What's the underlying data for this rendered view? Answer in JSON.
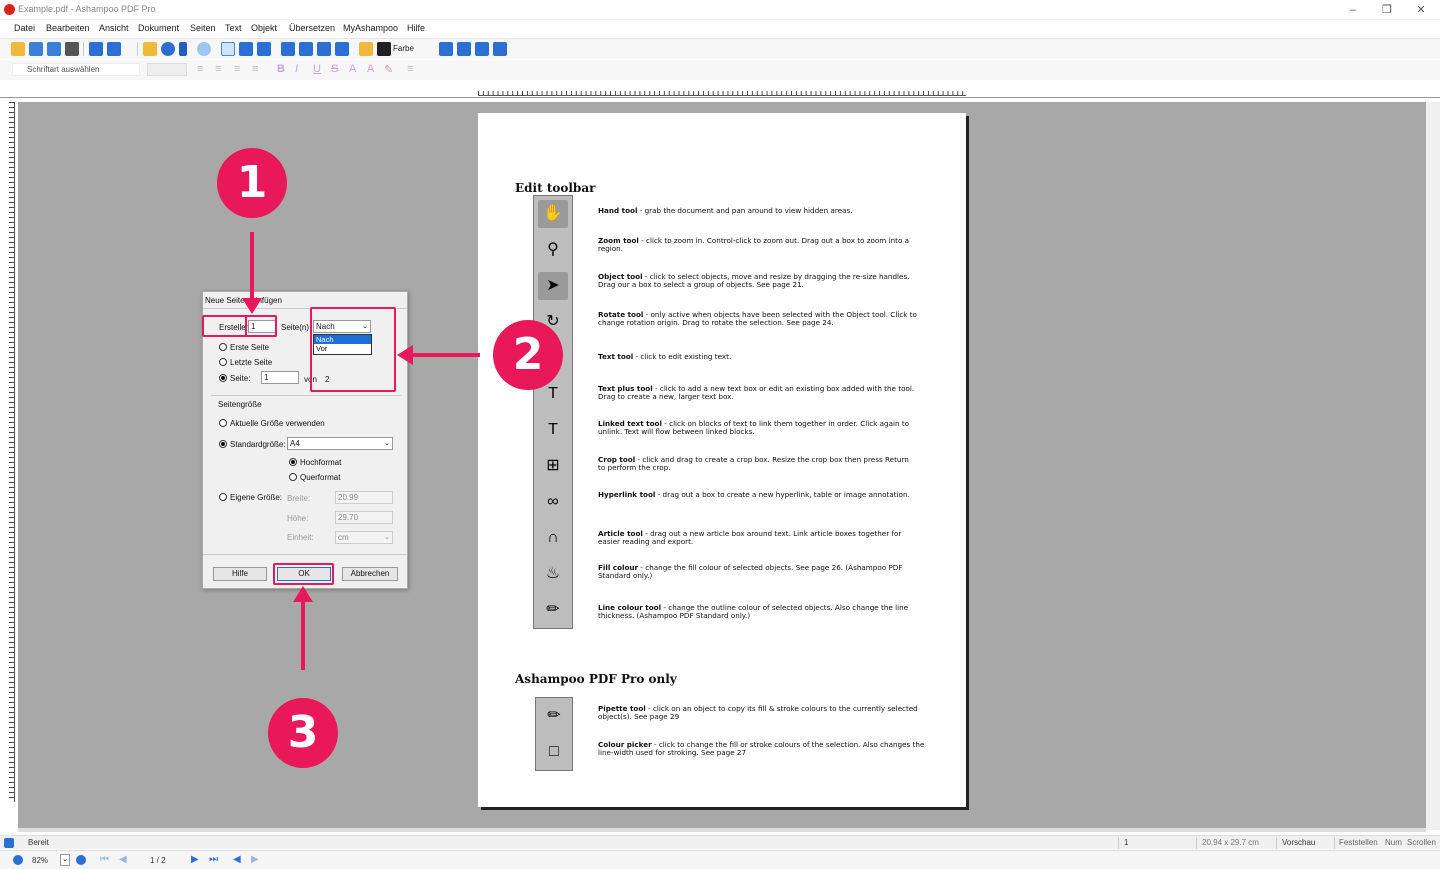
{
  "window": {
    "title": "Example.pdf - Ashampoo PDF Pro"
  },
  "menu": [
    "Datei",
    "Bearbeiten",
    "Ansicht",
    "Dokument",
    "Seiten",
    "Text",
    "Objekt",
    "Übersetzen",
    "MyAshampoo",
    "Hilfe"
  ],
  "toolbar": {
    "color_label": "Farbe",
    "font_placeholder": "Schriftart auswählen"
  },
  "page": {
    "heading1": "Edit toolbar",
    "tools": [
      {
        "name": "Hand tool",
        "desc": "- grab the document and pan around to view hidden areas."
      },
      {
        "name": "Zoom tool",
        "desc": "- click to zoom in. Control-click to zoom out. Drag out a box to zoom into a region."
      },
      {
        "name": "Object tool",
        "desc": "- click to select objects, move and resize by dragging the re-size handles. Drag our a box to select a group of objects. See page 21."
      },
      {
        "name": "Rotate tool",
        "desc": "- only active when objects have been selected with the Object tool. Click to change rotation origin. Drag to rotate the selection. See page 24."
      },
      {
        "name": "Text tool",
        "desc": "- click to edit existing text."
      },
      {
        "name": "Text plus tool",
        "desc": "- click to add a new text box or edit an existing box added with the tool. Drag to create a new, larger text box."
      },
      {
        "name": "Linked text tool",
        "desc": "- click on blocks of text to link them together in order. Click again to unlink. Text will flow between linked blocks."
      },
      {
        "name": "Crop tool",
        "desc": "- click and drag to create a crop box. Resize the crop box then press Return to perform the crop."
      },
      {
        "name": "Hyperlink tool",
        "desc": "- drag out a box to create a new hyperlink, table or image annotation."
      },
      {
        "name": "Article tool",
        "desc": "- drag out a new article box around text. Link article boxes together for easier reading and export."
      },
      {
        "name": "Fill colour",
        "desc": "- change the fill colour of selected objects. See page 26. (Ashampoo PDF Standard only.)"
      },
      {
        "name": "Line colour tool",
        "desc": "- change the outline colour of selected objects. Also change the line thickness. (Ashampoo PDF Standard only.)"
      }
    ],
    "heading2": "Ashampoo PDF Pro only",
    "pro_tools": [
      {
        "name": "Pipette tool",
        "desc": "- click on an object to copy its fill & stroke colours to the currently selected object(s). See page 29"
      },
      {
        "name": "Colour picker",
        "desc": "- click to change the fill or stroke colours of the selection. Also changes the line-width used for stroking. See page 27"
      }
    ]
  },
  "dialog": {
    "title": "Neue Seiten einfügen",
    "create_label": "Erstellen",
    "create_value": "1",
    "pages_label": "Seite(n)",
    "position_selected": "Nach",
    "position_options": [
      "Nach",
      "Vor"
    ],
    "first_page": "Erste Seite",
    "last_page": "Letzte Seite",
    "page_label": "Seite:",
    "page_value": "1",
    "of_label": "von",
    "of_value": "2",
    "size_group": "Seitengröße",
    "current_size": "Aktuelle Größe verwenden",
    "standard_size": "Standardgröße:",
    "standard_value": "A4",
    "portrait": "Hochformat",
    "landscape": "Querformat",
    "custom_size": "Eigene Größe:",
    "width_label": "Breite:",
    "width_value": "20.99",
    "height_label": "Höhe:",
    "height_value": "29.70",
    "unit_label": "Einheit:",
    "unit_value": "cm",
    "help_button": "Hilfe",
    "ok_button": "OK",
    "cancel_button": "Abbrechen"
  },
  "callouts": [
    "1",
    "2",
    "3"
  ],
  "status": {
    "ready": "Bereit",
    "page_field": "1",
    "page_size": "20.94 x 29.7 cm",
    "mode": "Vorschau",
    "caps": "Feststellen",
    "num": "Num",
    "scroll": "Scrollen"
  },
  "nav": {
    "zoom": "82%",
    "pages": "1 / 2"
  },
  "colors": {
    "accent": "#e8185a",
    "workspace": "#a8a8a8",
    "logo": "#d9231f"
  }
}
